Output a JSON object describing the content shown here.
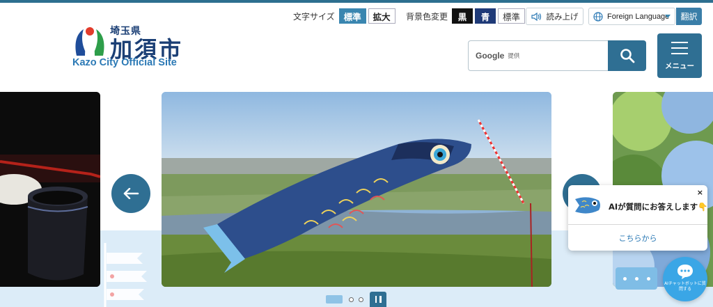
{
  "header": {
    "logo": {
      "prefecture": "埼玉県",
      "city": "加須市",
      "english": "Kazo City Official Site"
    },
    "font_size": {
      "label": "文字サイズ",
      "options": [
        "標準",
        "拡大"
      ],
      "selected": "標準"
    },
    "background_color": {
      "label": "背景色変更",
      "options": [
        "黒",
        "青",
        "標準"
      ]
    },
    "read_aloud": "読み上げ",
    "language": {
      "selected": "Foreign Language",
      "translate_label": "翻訳"
    },
    "search": {
      "brand": "Google",
      "provided_by": "提供"
    },
    "menu_label": "メニュー"
  },
  "slider": {
    "dot_count": 3,
    "active_index": 0
  },
  "chat": {
    "close_label": "×",
    "message": "AIが質問にお答えします👇",
    "link_text": "こちらから",
    "launcher_text": "AIチャットボットに質問する"
  },
  "colors": {
    "primary": "#2f6f93",
    "accent_blue": "#3a86b0",
    "logo_navy": "#1b3f75",
    "chat_blue": "#3aa6e6"
  }
}
